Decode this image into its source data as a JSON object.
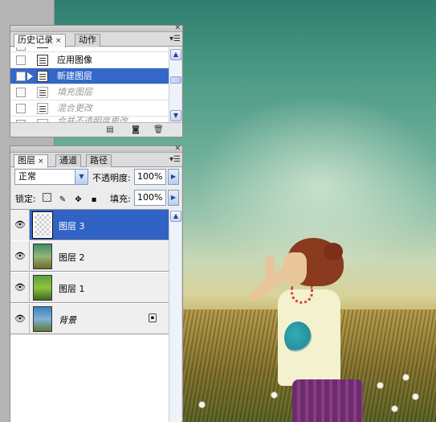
{
  "history_panel": {
    "tabs": [
      {
        "label": "历史记录",
        "active": true,
        "close": "×"
      },
      {
        "label": "动作",
        "active": false
      }
    ],
    "items": [
      {
        "label": "应用图像",
        "state": "normal"
      },
      {
        "label": "新建图层",
        "state": "selected"
      },
      {
        "label": "填充图层",
        "state": "disabled"
      },
      {
        "label": "混合更改",
        "state": "disabled"
      },
      {
        "label": "合并不透明度更改",
        "state": "disabled"
      }
    ],
    "icons": [
      "new-snapshot-icon",
      "camera-icon",
      "trash-icon"
    ]
  },
  "layers_panel": {
    "tabs": [
      {
        "label": "图层",
        "active": true,
        "close": "×"
      },
      {
        "label": "通道",
        "active": false
      },
      {
        "label": "路径",
        "active": false
      }
    ],
    "blend_mode": "正常",
    "opacity_label": "不透明度:",
    "opacity_value": "100%",
    "lock_label": "锁定:",
    "fill_label": "填充:",
    "fill_value": "100%",
    "layers": [
      {
        "name": "图层 3",
        "selected": true,
        "thumb": "transparent"
      },
      {
        "name": "图层 2",
        "selected": false,
        "thumb": "photo"
      },
      {
        "name": "图层 1",
        "selected": false,
        "thumb": "photo"
      },
      {
        "name": "背景",
        "selected": false,
        "thumb": "photo",
        "locked": true
      }
    ]
  },
  "colors": {
    "selection": "#3467c8",
    "panel_bg": "#ececec"
  }
}
